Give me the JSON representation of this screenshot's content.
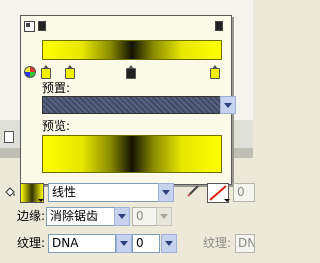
{
  "gradient_panel": {
    "preset_label": "预置:",
    "preset_value": "",
    "preview_label": "预览:"
  },
  "toolbar": {
    "fill_type_value": "线性",
    "edge_label": "边缘:",
    "edge_value": "消除锯齿",
    "edge_number": "0",
    "texture_label": "纹理:",
    "texture_value": "DNA",
    "texture_number": "0",
    "texture_label_right": "纹理:",
    "texture_value_right": "DN",
    "stroke_width_value": "0"
  },
  "colors": {
    "gradient_yellow": "#ffff00",
    "gradient_dark": "#111100",
    "panel_bg": "#fbfae9"
  }
}
